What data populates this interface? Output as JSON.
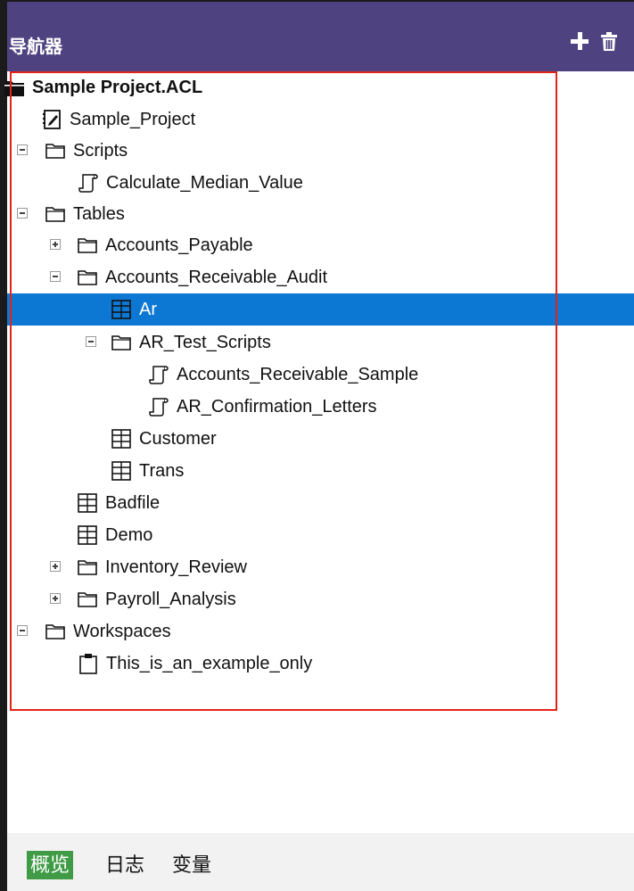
{
  "header": {
    "title": "导航器",
    "add_icon": "plus-icon",
    "delete_icon": "trash-icon"
  },
  "tree": {
    "items": [
      {
        "label": "Sample Project.ACL",
        "type": "project-root",
        "toggle": "none"
      },
      {
        "label": "Sample_Project",
        "type": "log",
        "toggle": "none"
      },
      {
        "label": "Scripts",
        "type": "folder",
        "toggle": "expanded"
      },
      {
        "label": "Calculate_Median_Value",
        "type": "script",
        "toggle": "none"
      },
      {
        "label": "Tables",
        "type": "folder",
        "toggle": "expanded"
      },
      {
        "label": "Accounts_Payable",
        "type": "folder",
        "toggle": "collapsed"
      },
      {
        "label": "Accounts_Receivable_Audit",
        "type": "folder",
        "toggle": "expanded"
      },
      {
        "label": "Ar",
        "type": "table",
        "toggle": "none",
        "selected": true
      },
      {
        "label": "AR_Test_Scripts",
        "type": "folder",
        "toggle": "expanded"
      },
      {
        "label": "Accounts_Receivable_Sample",
        "type": "script",
        "toggle": "none"
      },
      {
        "label": "AR_Confirmation_Letters",
        "type": "script",
        "toggle": "none"
      },
      {
        "label": "Customer",
        "type": "table",
        "toggle": "none"
      },
      {
        "label": "Trans",
        "type": "table",
        "toggle": "none"
      },
      {
        "label": "Badfile",
        "type": "table",
        "toggle": "none"
      },
      {
        "label": "Demo",
        "type": "table",
        "toggle": "none"
      },
      {
        "label": "Inventory_Review",
        "type": "folder",
        "toggle": "collapsed"
      },
      {
        "label": "Payroll_Analysis",
        "type": "folder",
        "toggle": "collapsed"
      },
      {
        "label": "Workspaces",
        "type": "folder",
        "toggle": "expanded"
      },
      {
        "label": "This_is_an_example_only",
        "type": "workspace",
        "toggle": "none"
      }
    ]
  },
  "bottom_tabs": [
    {
      "label": "概览",
      "active": true
    },
    {
      "label": "日志",
      "active": false
    },
    {
      "label": "变量",
      "active": false
    }
  ],
  "colors": {
    "header_bg": "#4e4380",
    "selection": "#0d78d4",
    "highlight_border": "#e2231a",
    "active_tab": "#3f9b45"
  }
}
